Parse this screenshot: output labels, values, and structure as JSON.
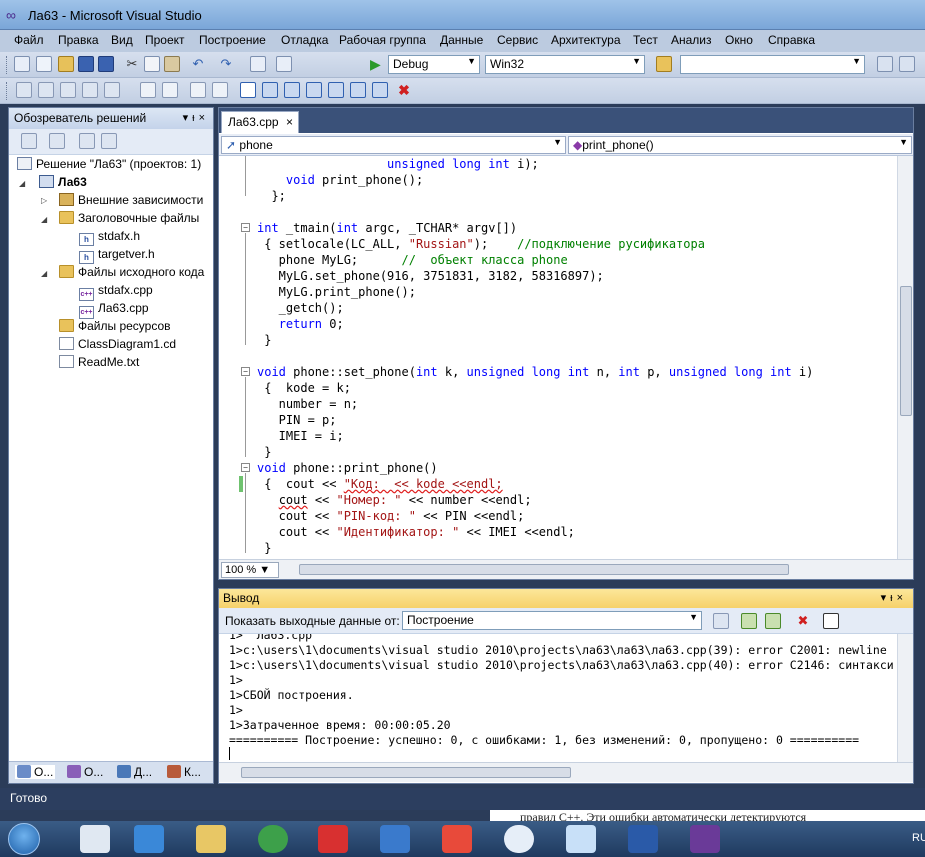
{
  "window": {
    "title": "Ла63 - Microsoft Visual Studio"
  },
  "menu": [
    "Файл",
    "Правка",
    "Вид",
    "Проект",
    "Построение",
    "Отладка",
    "Рабочая группа",
    "Данные",
    "Сервис",
    "Архитектура",
    "Тест",
    "Анализ",
    "Окно",
    "Справка"
  ],
  "toolbar": {
    "config": "Debug",
    "platform": "Win32",
    "search_value": ""
  },
  "solution_explorer": {
    "title": "Обозреватель решений",
    "tree": [
      {
        "label": "Решение \"Ла63\"  (проектов: 1)",
        "icon": "solution-icon"
      },
      {
        "label": "Ла63",
        "icon": "project-icon",
        "bold": true
      },
      {
        "label": "Внешние зависимости",
        "icon": "dependencies-folder-icon"
      },
      {
        "label": "Заголовочные файлы",
        "icon": "folder-icon"
      },
      {
        "label": "stdafx.h",
        "icon": "header-file-icon"
      },
      {
        "label": "targetver.h",
        "icon": "header-file-icon"
      },
      {
        "label": "Файлы исходного кода",
        "icon": "folder-icon"
      },
      {
        "label": "stdafx.cpp",
        "icon": "cpp-file-icon"
      },
      {
        "label": "Ла63.cpp",
        "icon": "cpp-file-icon"
      },
      {
        "label": "Файлы ресурсов",
        "icon": "folder-icon"
      },
      {
        "label": "ClassDiagram1.cd",
        "icon": "diagram-file-icon"
      },
      {
        "label": "ReadMe.txt",
        "icon": "text-file-icon"
      }
    ],
    "tabs": [
      "О...",
      "О...",
      "Д...",
      "К..."
    ]
  },
  "editor": {
    "tab": "Ла63.cpp",
    "nav_left": "phone",
    "nav_right": "print_phone()",
    "zoom": "100 %",
    "lines": [
      [
        [
          "",
          "                  "
        ],
        [
          "kw",
          "unsigned long int"
        ],
        [
          "",
          " i);"
        ]
      ],
      [
        [
          "",
          "    "
        ],
        [
          "kw",
          "void"
        ],
        [
          "",
          " print_phone();"
        ]
      ],
      [
        [
          "",
          "  };"
        ]
      ],
      [
        [
          "",
          ""
        ]
      ],
      [
        [
          "kw",
          "int"
        ],
        [
          "",
          " _tmain("
        ],
        [
          "kw",
          "int"
        ],
        [
          "",
          " argc, _TCHAR* argv[])"
        ]
      ],
      [
        [
          "",
          " { setlocale(LC_ALL, "
        ],
        [
          "st",
          "\"Russian\""
        ],
        [
          "",
          ");    "
        ],
        [
          "cm",
          "//подключение русификатора"
        ]
      ],
      [
        [
          "",
          "   phone MyLG;      "
        ],
        [
          "cm",
          "//  объект класса phone"
        ]
      ],
      [
        [
          "",
          "   MyLG.set_phone(916, 3751831, 3182, 58316897);"
        ]
      ],
      [
        [
          "",
          "   MyLG.print_phone();"
        ]
      ],
      [
        [
          "",
          "   _getch();"
        ]
      ],
      [
        [
          "",
          "   "
        ],
        [
          "kw",
          "return"
        ],
        [
          "",
          " 0;"
        ]
      ],
      [
        [
          "",
          " }"
        ]
      ],
      [
        [
          "",
          ""
        ]
      ],
      [
        [
          "kw",
          "void"
        ],
        [
          "",
          " phone::set_phone("
        ],
        [
          "kw",
          "int"
        ],
        [
          "",
          " k, "
        ],
        [
          "kw",
          "unsigned long int"
        ],
        [
          "",
          " n, "
        ],
        [
          "kw",
          "int"
        ],
        [
          "",
          " p, "
        ],
        [
          "kw",
          "unsigned long int"
        ],
        [
          "",
          " i)"
        ]
      ],
      [
        [
          "",
          " {  kode = k;"
        ]
      ],
      [
        [
          "",
          "   number = n;"
        ]
      ],
      [
        [
          "",
          "   PIN = p;"
        ]
      ],
      [
        [
          "",
          "   IMEI = i;"
        ]
      ],
      [
        [
          "",
          " }"
        ]
      ],
      [
        [
          "kw",
          "void"
        ],
        [
          "",
          " phone::print_phone()"
        ]
      ],
      [
        [
          "",
          " {  cout << "
        ],
        [
          "stsq",
          "\"Код:  << kode <<endl;"
        ]
      ],
      [
        [
          "",
          "   "
        ],
        [
          "sq",
          "cout"
        ],
        [
          "",
          " << "
        ],
        [
          "st",
          "\"Номер: \""
        ],
        [
          "",
          " << number <<endl;"
        ]
      ],
      [
        [
          "",
          "   cout << "
        ],
        [
          "st",
          "\"PIN-код: \""
        ],
        [
          "",
          " << PIN <<endl;"
        ]
      ],
      [
        [
          "",
          "   cout << "
        ],
        [
          "st",
          "\"Идентификатор: \""
        ],
        [
          "",
          " << IMEI <<endl;"
        ]
      ],
      [
        [
          "",
          " }"
        ]
      ]
    ]
  },
  "output": {
    "title": "Вывод",
    "label": "Показать выходные данные от:",
    "source": "Построение",
    "lines": [
      "1>  Ла63.cpp",
      "1>c:\\users\\1\\documents\\visual studio 2010\\projects\\ла63\\ла63\\ла63.cpp(39): error C2001: newline",
      "1>c:\\users\\1\\documents\\visual studio 2010\\projects\\ла63\\ла63\\ла63.cpp(40): error C2146: синтакси",
      "1>",
      "1>СБОЙ построения.",
      "1>",
      "1>Затраченное время: 00:00:05.20",
      "========== Построение: успешно: 0, с ошибками: 1, без изменений: 0, пропущено: 0 =========="
    ]
  },
  "status": "Готово",
  "behind_text": "правил С++. Эти ошибки автоматически детектируются",
  "taskbar": {
    "lang": "RU"
  }
}
